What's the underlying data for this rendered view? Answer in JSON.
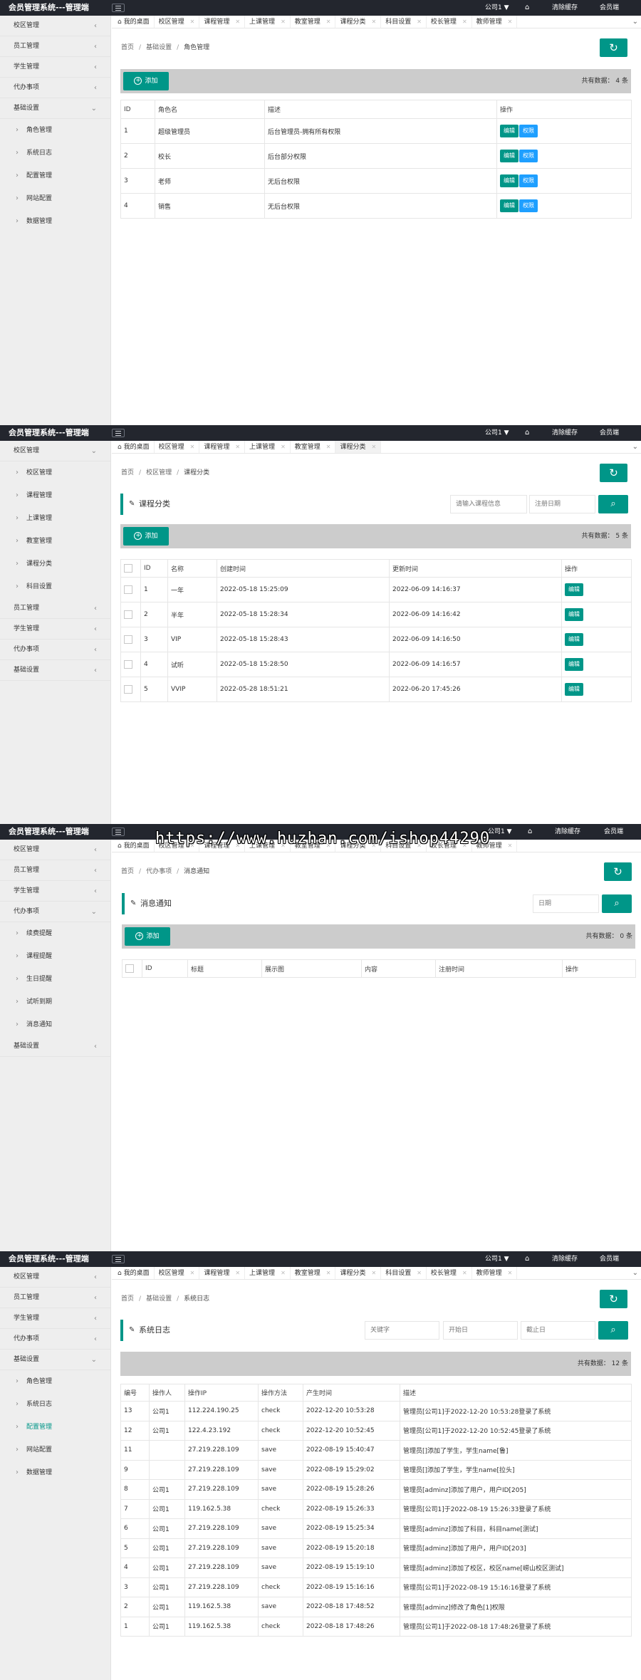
{
  "app": {
    "title": "会员管理系统---管理端",
    "company": "公司1",
    "clear_cache": "清除缓存",
    "member_end": "会员端"
  },
  "tabs": {
    "home": "我的桌面",
    "campus": "校区管理",
    "course": "课程管理",
    "class": "上课管理",
    "room": "教室管理",
    "course_cat": "课程分类",
    "subject": "科目设置",
    "principal": "校长管理",
    "teacher": "教师管理"
  },
  "menu": {
    "campus": "校区管理",
    "staff": "员工管理",
    "student": "学生管理",
    "agenda": "代办事项",
    "basic": "基础设置",
    "role": "角色管理",
    "syslog": "系统日志",
    "config": "配置管理",
    "site": "网站配置",
    "data": "数据管理",
    "campus_sub": "校区管理",
    "course": "课程管理",
    "class": "上课管理",
    "room": "教室管理",
    "course_cat": "课程分类",
    "subject": "科目设置",
    "fee": "续费提醒",
    "course_remind": "课程提醒",
    "birthday": "生日提醒",
    "trial": "试听到期",
    "notice": "消息通知"
  },
  "crumbs": {
    "home": "首页",
    "basic": "基础设置",
    "campus": "校区管理",
    "agenda": "代办事项",
    "role": "角色管理",
    "course_cat": "课程分类",
    "notice": "消息通知",
    "syslog": "系统日志"
  },
  "common": {
    "add": "添加",
    "edit": "编辑",
    "perm": "权限"
  },
  "roles": {
    "total": "共有数据： 4 条",
    "headers": [
      "ID",
      "角色名",
      "描述",
      "操作"
    ],
    "rows": [
      {
        "id": "1",
        "name": "超级管理员",
        "desc": "后台管理员-拥有所有权限"
      },
      {
        "id": "2",
        "name": "校长",
        "desc": "后台部分权限"
      },
      {
        "id": "3",
        "name": "老师",
        "desc": "无后台权限"
      },
      {
        "id": "4",
        "name": "销售",
        "desc": "无后台权限"
      }
    ]
  },
  "course_cat": {
    "title": "课程分类",
    "search_placeholder": "请输入课程信息",
    "date_placeholder": "注册日期",
    "total": "共有数据： 5 条",
    "headers": [
      "ID",
      "名称",
      "创建时间",
      "更新时间",
      "操作"
    ],
    "rows": [
      {
        "id": "1",
        "name": "一年",
        "created": "2022-05-18 15:25:09",
        "updated": "2022-06-09 14:16:37"
      },
      {
        "id": "2",
        "name": "半年",
        "created": "2022-05-18 15:28:34",
        "updated": "2022-06-09 14:16:42"
      },
      {
        "id": "3",
        "name": "VIP",
        "created": "2022-05-18 15:28:43",
        "updated": "2022-06-09 14:16:50"
      },
      {
        "id": "4",
        "name": "试听",
        "created": "2022-05-18 15:28:50",
        "updated": "2022-06-09 14:16:57"
      },
      {
        "id": "5",
        "name": "VVIP",
        "created": "2022-05-28 18:51:21",
        "updated": "2022-06-20 17:45:26"
      }
    ]
  },
  "notice": {
    "title": "消息通知",
    "date_placeholder": "日期",
    "total": "共有数据： 0 条",
    "headers": [
      "ID",
      "标题",
      "展示图",
      "内容",
      "注册时间",
      "操作"
    ]
  },
  "syslog": {
    "title": "系统日志",
    "keyword_placeholder": "关键字",
    "start_placeholder": "开始日",
    "end_placeholder": "截止日",
    "total": "共有数据： 12 条",
    "headers": [
      "编号",
      "操作人",
      "操作IP",
      "操作方法",
      "产生时间",
      "描述"
    ],
    "rows": [
      {
        "id": "13",
        "user": "公司1",
        "ip": "112.224.190.25",
        "method": "check",
        "time": "2022-12-20 10:53:28",
        "desc": "管理员[公司1]于2022-12-20 10:53:28登录了系统"
      },
      {
        "id": "12",
        "user": "公司1",
        "ip": "122.4.23.192",
        "method": "check",
        "time": "2022-12-20 10:52:45",
        "desc": "管理员[公司1]于2022-12-20 10:52:45登录了系统"
      },
      {
        "id": "11",
        "user": "",
        "ip": "27.219.228.109",
        "method": "save",
        "time": "2022-08-19 15:40:47",
        "desc": "管理员[]添加了学生，学生name[鲁]"
      },
      {
        "id": "9",
        "user": "",
        "ip": "27.219.228.109",
        "method": "save",
        "time": "2022-08-19 15:29:02",
        "desc": "管理员[]添加了学生，学生name[拉头]"
      },
      {
        "id": "8",
        "user": "公司1",
        "ip": "27.219.228.109",
        "method": "save",
        "time": "2022-08-19 15:28:26",
        "desc": "管理员[adminz]添加了用户，用户ID[205]"
      },
      {
        "id": "7",
        "user": "公司1",
        "ip": "119.162.5.38",
        "method": "check",
        "time": "2022-08-19 15:26:33",
        "desc": "管理员[公司1]于2022-08-19 15:26:33登录了系统"
      },
      {
        "id": "6",
        "user": "公司1",
        "ip": "27.219.228.109",
        "method": "save",
        "time": "2022-08-19 15:25:34",
        "desc": "管理员[adminz]添加了科目，科目name[测试]"
      },
      {
        "id": "5",
        "user": "公司1",
        "ip": "27.219.228.109",
        "method": "save",
        "time": "2022-08-19 15:20:18",
        "desc": "管理员[adminz]添加了用户，用户ID[203]"
      },
      {
        "id": "4",
        "user": "公司1",
        "ip": "27.219.228.109",
        "method": "save",
        "time": "2022-08-19 15:19:10",
        "desc": "管理员[adminz]添加了校区，校区name[崂山校区测试]"
      },
      {
        "id": "3",
        "user": "公司1",
        "ip": "27.219.228.109",
        "method": "check",
        "time": "2022-08-19 15:16:16",
        "desc": "管理员[公司1]于2022-08-19 15:16:16登录了系统"
      },
      {
        "id": "2",
        "user": "公司1",
        "ip": "119.162.5.38",
        "method": "save",
        "time": "2022-08-18 17:48:52",
        "desc": "管理员[adminz]修改了角色[1]权限"
      },
      {
        "id": "1",
        "user": "公司1",
        "ip": "119.162.5.38",
        "method": "check",
        "time": "2022-08-18 17:48:26",
        "desc": "管理员[公司1]于2022-08-18 17:48:26登录了系统"
      }
    ]
  },
  "watermark": "https://www.huzhan.com/ishop44290",
  "colors": {
    "primary": "#009688",
    "perm": "#1e9fff",
    "topbar": "#23262e",
    "sidebar": "#eeeeee"
  }
}
